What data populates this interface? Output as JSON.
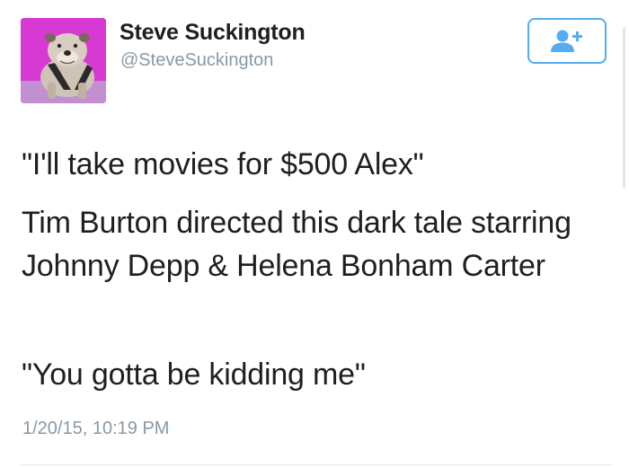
{
  "user": {
    "display_name": "Steve Suckington",
    "handle": "@SteveSuckington",
    "avatar_icon": "bulldog-avatar",
    "avatar_bg": "#d73ad2"
  },
  "follow_button": {
    "icon": "follow-user-plus-icon",
    "accent": "#55acee"
  },
  "tweet": {
    "paragraphs": [
      "\"I'll take movies for $500 Alex\"",
      "Tim Burton directed this dark tale starring Johnny Depp & Helena Bonham Carter",
      "\"You gotta be kidding me\""
    ],
    "timestamp": "1/20/15, 10:19 PM"
  }
}
